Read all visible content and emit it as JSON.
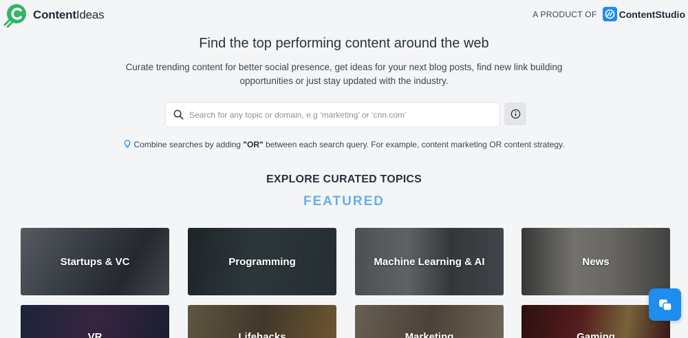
{
  "header": {
    "logo_bold": "Content",
    "logo_light": "Ideas",
    "product_prefix": "A PRODUCT OF",
    "product_name": "ContentStudio"
  },
  "hero": {
    "title": "Find the top performing content around the web",
    "subtitle": "Curate trending content for better social presence, get ideas for your next blog posts, find new link building opportunities or just stay updated with the industry."
  },
  "search": {
    "placeholder": "Search for any topic or domain, e.g ‘marketing’ or ‘cnn.com’",
    "value": ""
  },
  "tip": {
    "before": "Combine searches by adding ",
    "keyword": "\"OR\"",
    "after": " between each search query. For example, content marketing OR content strategy."
  },
  "sections": {
    "explore": "EXPLORE CURATED TOPICS",
    "featured": "FEATURED"
  },
  "topics": [
    {
      "label": "Startups & VC",
      "icon": "business-meeting-photo",
      "color": "#5b6470"
    },
    {
      "label": "Programming",
      "icon": "code-screen-photo",
      "color": "#3c4a52"
    },
    {
      "label": "Machine Learning & AI",
      "icon": "people-photo",
      "color": "#6a6f78"
    },
    {
      "label": "News",
      "icon": "newspaper-photo",
      "color": "#8a8a86"
    },
    {
      "label": "VR",
      "icon": "vr-headset-photo",
      "color": "#2e3a5c"
    },
    {
      "label": "Lifehacks",
      "icon": "tools-photo",
      "color": "#7a6b52"
    },
    {
      "label": "Marketing",
      "icon": "desk-photo",
      "color": "#8a7a68"
    },
    {
      "label": "Gaming",
      "icon": "gaming-poster-photo",
      "color": "#7a2a2a"
    }
  ],
  "colors": {
    "accent": "#1d8df0",
    "featured": "#6aaee8",
    "logo_green": "#2fb765"
  }
}
